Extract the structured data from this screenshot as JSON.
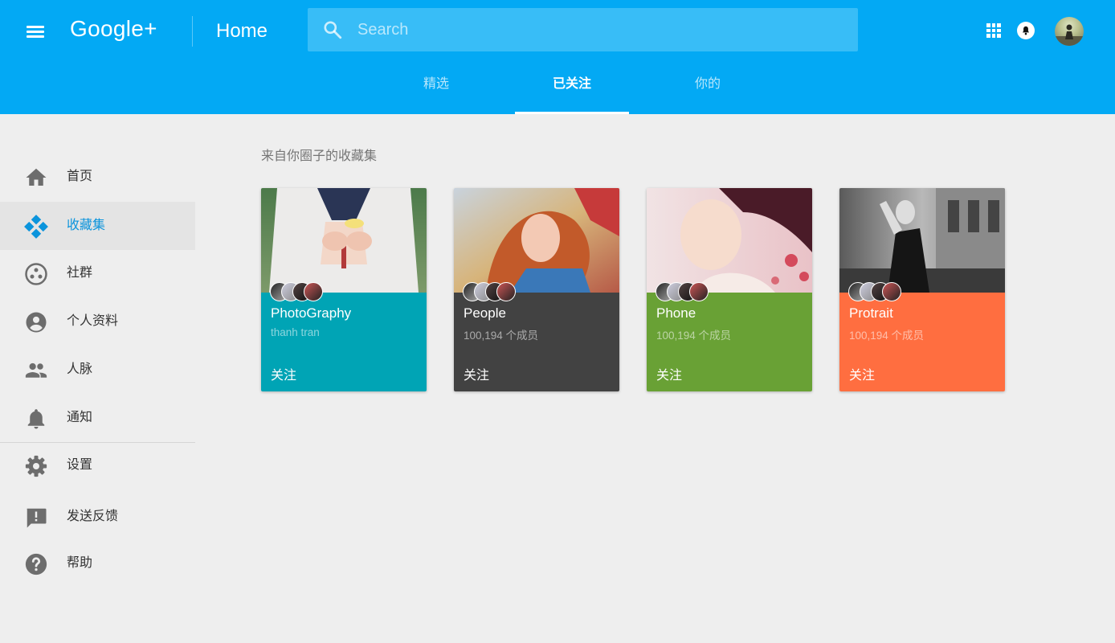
{
  "header": {
    "brand": "Google+",
    "page_title": "Home",
    "search_placeholder": "Search",
    "tabs": [
      {
        "label": "精选"
      },
      {
        "label": "已关注"
      },
      {
        "label": "你的"
      }
    ],
    "active_tab": "已关注"
  },
  "sidebar": {
    "items": [
      {
        "label": "首页",
        "icon": "home-icon"
      },
      {
        "label": "收藏集",
        "icon": "collections-icon"
      },
      {
        "label": "社群",
        "icon": "communities-icon"
      },
      {
        "label": "个人资料",
        "icon": "profile-icon"
      },
      {
        "label": "人脉",
        "icon": "people-icon"
      },
      {
        "label": "通知",
        "icon": "notifications-icon"
      },
      {
        "label": "设置",
        "icon": "settings-icon"
      },
      {
        "label": "发送反馈",
        "icon": "feedback-icon"
      },
      {
        "label": "帮助",
        "icon": "help-icon"
      }
    ],
    "active_item": "收藏集"
  },
  "main": {
    "section_title": "来自你圈子的收藏集",
    "cards": [
      {
        "name": "PhotoGraphy",
        "subtitle": "thanh tran",
        "follow_label": "关注",
        "color": "#00a4b5"
      },
      {
        "name": "People",
        "subtitle": "100,194 个成员",
        "follow_label": "关注",
        "color": "#424242"
      },
      {
        "name": "Phone",
        "subtitle": "100,194 个成员",
        "follow_label": "关注",
        "color": "#69a135"
      },
      {
        "name": "Protrait",
        "subtitle": "100,194 个成员",
        "follow_label": "关注",
        "color": "#ff6e40"
      }
    ]
  },
  "colors": {
    "app_bar": "#03a9f4",
    "accent": "#0b94dc",
    "background": "#eeeeee"
  }
}
